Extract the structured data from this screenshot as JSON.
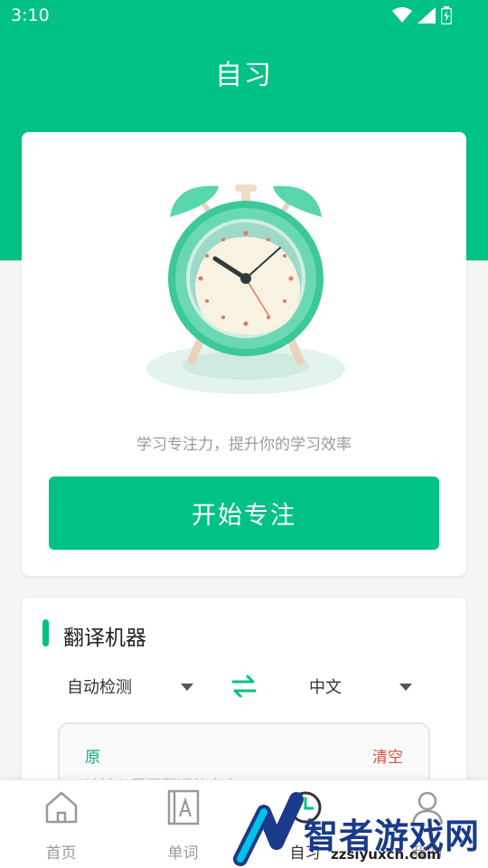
{
  "status_bar": {
    "time": "3:10"
  },
  "header": {
    "title": "自习"
  },
  "focus_card": {
    "tagline": "学习专注力，提升你的学习效率",
    "start_button": "开始专注"
  },
  "translator": {
    "title": "翻译机器",
    "source_lang": "自动检测",
    "target_lang": "中文",
    "original_label": "原",
    "clear_label": "清空",
    "placeholder": "请输入需要翻译的文本"
  },
  "tabbar": {
    "items": [
      {
        "label": "首页",
        "icon": "home-icon"
      },
      {
        "label": "单词",
        "icon": "word-book-icon"
      },
      {
        "label": "自习",
        "icon": "clock-icon",
        "active": true
      },
      {
        "label": "我的",
        "icon": "user-icon"
      }
    ]
  },
  "watermark": {
    "text": "智者游戏网",
    "url": "zzsiyuxcn.com"
  },
  "colors": {
    "brand": "#00c285",
    "clear": "#e04a3a"
  }
}
